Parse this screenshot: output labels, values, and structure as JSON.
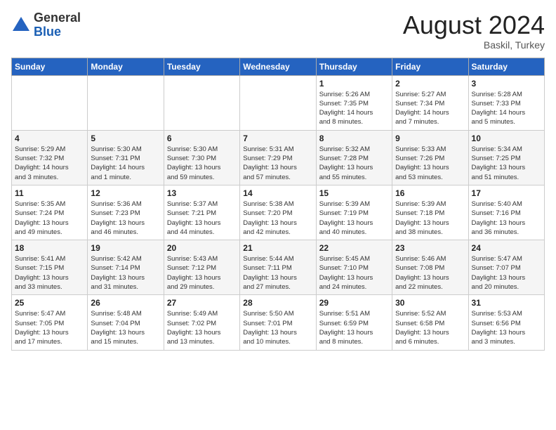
{
  "header": {
    "logo_general": "General",
    "logo_blue": "Blue",
    "month_year": "August 2024",
    "location": "Baskil, Turkey"
  },
  "weekdays": [
    "Sunday",
    "Monday",
    "Tuesday",
    "Wednesday",
    "Thursday",
    "Friday",
    "Saturday"
  ],
  "weeks": [
    [
      {
        "day": "",
        "info": ""
      },
      {
        "day": "",
        "info": ""
      },
      {
        "day": "",
        "info": ""
      },
      {
        "day": "",
        "info": ""
      },
      {
        "day": "1",
        "info": "Sunrise: 5:26 AM\nSunset: 7:35 PM\nDaylight: 14 hours\nand 8 minutes."
      },
      {
        "day": "2",
        "info": "Sunrise: 5:27 AM\nSunset: 7:34 PM\nDaylight: 14 hours\nand 7 minutes."
      },
      {
        "day": "3",
        "info": "Sunrise: 5:28 AM\nSunset: 7:33 PM\nDaylight: 14 hours\nand 5 minutes."
      }
    ],
    [
      {
        "day": "4",
        "info": "Sunrise: 5:29 AM\nSunset: 7:32 PM\nDaylight: 14 hours\nand 3 minutes."
      },
      {
        "day": "5",
        "info": "Sunrise: 5:30 AM\nSunset: 7:31 PM\nDaylight: 14 hours\nand 1 minute."
      },
      {
        "day": "6",
        "info": "Sunrise: 5:30 AM\nSunset: 7:30 PM\nDaylight: 13 hours\nand 59 minutes."
      },
      {
        "day": "7",
        "info": "Sunrise: 5:31 AM\nSunset: 7:29 PM\nDaylight: 13 hours\nand 57 minutes."
      },
      {
        "day": "8",
        "info": "Sunrise: 5:32 AM\nSunset: 7:28 PM\nDaylight: 13 hours\nand 55 minutes."
      },
      {
        "day": "9",
        "info": "Sunrise: 5:33 AM\nSunset: 7:26 PM\nDaylight: 13 hours\nand 53 minutes."
      },
      {
        "day": "10",
        "info": "Sunrise: 5:34 AM\nSunset: 7:25 PM\nDaylight: 13 hours\nand 51 minutes."
      }
    ],
    [
      {
        "day": "11",
        "info": "Sunrise: 5:35 AM\nSunset: 7:24 PM\nDaylight: 13 hours\nand 49 minutes."
      },
      {
        "day": "12",
        "info": "Sunrise: 5:36 AM\nSunset: 7:23 PM\nDaylight: 13 hours\nand 46 minutes."
      },
      {
        "day": "13",
        "info": "Sunrise: 5:37 AM\nSunset: 7:21 PM\nDaylight: 13 hours\nand 44 minutes."
      },
      {
        "day": "14",
        "info": "Sunrise: 5:38 AM\nSunset: 7:20 PM\nDaylight: 13 hours\nand 42 minutes."
      },
      {
        "day": "15",
        "info": "Sunrise: 5:39 AM\nSunset: 7:19 PM\nDaylight: 13 hours\nand 40 minutes."
      },
      {
        "day": "16",
        "info": "Sunrise: 5:39 AM\nSunset: 7:18 PM\nDaylight: 13 hours\nand 38 minutes."
      },
      {
        "day": "17",
        "info": "Sunrise: 5:40 AM\nSunset: 7:16 PM\nDaylight: 13 hours\nand 36 minutes."
      }
    ],
    [
      {
        "day": "18",
        "info": "Sunrise: 5:41 AM\nSunset: 7:15 PM\nDaylight: 13 hours\nand 33 minutes."
      },
      {
        "day": "19",
        "info": "Sunrise: 5:42 AM\nSunset: 7:14 PM\nDaylight: 13 hours\nand 31 minutes."
      },
      {
        "day": "20",
        "info": "Sunrise: 5:43 AM\nSunset: 7:12 PM\nDaylight: 13 hours\nand 29 minutes."
      },
      {
        "day": "21",
        "info": "Sunrise: 5:44 AM\nSunset: 7:11 PM\nDaylight: 13 hours\nand 27 minutes."
      },
      {
        "day": "22",
        "info": "Sunrise: 5:45 AM\nSunset: 7:10 PM\nDaylight: 13 hours\nand 24 minutes."
      },
      {
        "day": "23",
        "info": "Sunrise: 5:46 AM\nSunset: 7:08 PM\nDaylight: 13 hours\nand 22 minutes."
      },
      {
        "day": "24",
        "info": "Sunrise: 5:47 AM\nSunset: 7:07 PM\nDaylight: 13 hours\nand 20 minutes."
      }
    ],
    [
      {
        "day": "25",
        "info": "Sunrise: 5:47 AM\nSunset: 7:05 PM\nDaylight: 13 hours\nand 17 minutes."
      },
      {
        "day": "26",
        "info": "Sunrise: 5:48 AM\nSunset: 7:04 PM\nDaylight: 13 hours\nand 15 minutes."
      },
      {
        "day": "27",
        "info": "Sunrise: 5:49 AM\nSunset: 7:02 PM\nDaylight: 13 hours\nand 13 minutes."
      },
      {
        "day": "28",
        "info": "Sunrise: 5:50 AM\nSunset: 7:01 PM\nDaylight: 13 hours\nand 10 minutes."
      },
      {
        "day": "29",
        "info": "Sunrise: 5:51 AM\nSunset: 6:59 PM\nDaylight: 13 hours\nand 8 minutes."
      },
      {
        "day": "30",
        "info": "Sunrise: 5:52 AM\nSunset: 6:58 PM\nDaylight: 13 hours\nand 6 minutes."
      },
      {
        "day": "31",
        "info": "Sunrise: 5:53 AM\nSunset: 6:56 PM\nDaylight: 13 hours\nand 3 minutes."
      }
    ]
  ]
}
